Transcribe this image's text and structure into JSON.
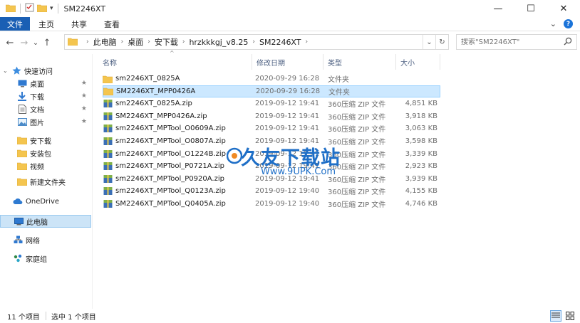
{
  "window": {
    "title": "SM2246XT",
    "minimize": "—",
    "maximize": "☐",
    "close": "✕"
  },
  "ribbon": {
    "tabs": [
      "文件",
      "主页",
      "共享",
      "查看"
    ],
    "expand": "⌄"
  },
  "address": {
    "back": "←",
    "forward": "→",
    "recent": "⌄",
    "up": "↑",
    "crumbs": [
      "此电脑",
      "桌面",
      "安下载",
      "hrzkkkgj_v8.25",
      "SM2246XT"
    ],
    "dropdown": "⌄",
    "refresh": "↻"
  },
  "search": {
    "placeholder": "搜索\"SM2246XT\""
  },
  "nav": {
    "items": [
      {
        "label": "快速访问",
        "icon": "star-icon"
      },
      {
        "label": "桌面",
        "icon": "desktop-icon",
        "pin": "★"
      },
      {
        "label": "下载",
        "icon": "download-icon",
        "pin": "★"
      },
      {
        "label": "文档",
        "icon": "document-icon",
        "pin": "★"
      },
      {
        "label": "图片",
        "icon": "picture-icon",
        "pin": "★"
      },
      {
        "label": "安下载",
        "icon": "folder-icon"
      },
      {
        "label": "安装包",
        "icon": "folder-icon"
      },
      {
        "label": "视频",
        "icon": "folder-icon"
      },
      {
        "label": "新建文件夹",
        "icon": "folder-icon"
      },
      {
        "label": "OneDrive",
        "icon": "cloud-icon"
      },
      {
        "label": "此电脑",
        "icon": "computer-icon"
      },
      {
        "label": "网络",
        "icon": "network-icon"
      },
      {
        "label": "家庭组",
        "icon": "homegroup-icon"
      }
    ]
  },
  "columns": {
    "name": "名称",
    "modified": "修改日期",
    "type": "类型",
    "size": "大小",
    "sort_arrow": "^"
  },
  "files": [
    {
      "name": "sm2246XT_0825A",
      "date": "2020-09-29 16:28",
      "type": "文件夹",
      "size": "",
      "kind": "folder"
    },
    {
      "name": "SM2246XT_MPP0426A",
      "date": "2020-09-29 16:28",
      "type": "文件夹",
      "size": "",
      "kind": "folder"
    },
    {
      "name": "sm2246XT_0825A.zip",
      "date": "2019-09-12 19:41",
      "type": "360压缩 ZIP 文件",
      "size": "4,851 KB",
      "kind": "zip"
    },
    {
      "name": "SM2246XT_MPP0426A.zip",
      "date": "2019-09-12 19:41",
      "type": "360压缩 ZIP 文件",
      "size": "3,918 KB",
      "kind": "zip"
    },
    {
      "name": "sm2246XT_MPTool_O0609A.zip",
      "date": "2019-09-12 19:41",
      "type": "360压缩 ZIP 文件",
      "size": "3,063 KB",
      "kind": "zip"
    },
    {
      "name": "sm2246XT_MPTool_O0807A.zip",
      "date": "2019-09-12 19:41",
      "type": "360压缩 ZIP 文件",
      "size": "3,598 KB",
      "kind": "zip"
    },
    {
      "name": "sm2246XT_MPTool_O1224B.zip",
      "date": "2019-09-12 19:41",
      "type": "360压缩 ZIP 文件",
      "size": "3,339 KB",
      "kind": "zip"
    },
    {
      "name": "sm2246XT_MPTool_P0721A.zip",
      "date": "2019-09-12 19:41",
      "type": "360压缩 ZIP 文件",
      "size": "2,923 KB",
      "kind": "zip"
    },
    {
      "name": "sm2246XT_MPTool_P0920A.zip",
      "date": "2019-09-12 19:41",
      "type": "360压缩 ZIP 文件",
      "size": "3,939 KB",
      "kind": "zip"
    },
    {
      "name": "sm2246XT_MPTool_Q0123A.zip",
      "date": "2019-09-12 19:40",
      "type": "360压缩 ZIP 文件",
      "size": "4,155 KB",
      "kind": "zip"
    },
    {
      "name": "SM2246XT_MPTool_Q0405A.zip",
      "date": "2019-09-12 19:40",
      "type": "360压缩 ZIP 文件",
      "size": "4,746 KB",
      "kind": "zip"
    }
  ],
  "selected_index": 1,
  "watermark": {
    "text": "久友下载站",
    "url": "Www.9UPK.Com"
  },
  "status": {
    "count": "11 个项目",
    "selected": "选中 1 个项目"
  },
  "colors": {
    "accent": "#1a5fb4",
    "selection": "#cce8ff",
    "folder": "#f4c54f",
    "header_text": "#4d6082"
  }
}
